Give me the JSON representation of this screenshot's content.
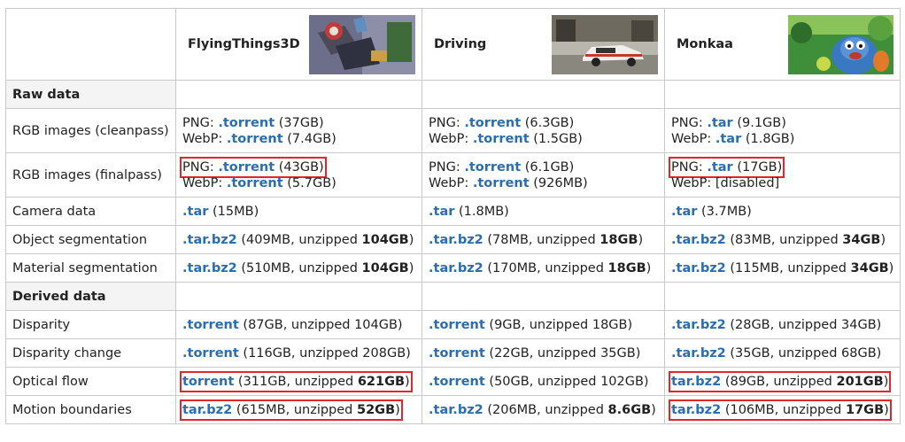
{
  "header": {
    "datasets": [
      {
        "name": "FlyingThings3D",
        "thumb_icon": "flyingthings3d-thumbnail"
      },
      {
        "name": "Driving",
        "thumb_icon": "driving-car-thumbnail"
      },
      {
        "name": "Monkaa",
        "thumb_icon": "monkaa-character-thumbnail"
      }
    ]
  },
  "sections": {
    "raw": "Raw data",
    "derived": "Derived data"
  },
  "rows": {
    "clean": {
      "label": "RGB images (cleanpass)",
      "ft": {
        "p1": "PNG: ",
        "l1": ".torrent",
        "s1": " (37GB)",
        "p2": "WebP: ",
        "l2": ".torrent",
        "s2": " (7.4GB)"
      },
      "dr": {
        "p1": "PNG: ",
        "l1": ".torrent",
        "s1": " (6.3GB)",
        "p2": "WebP: ",
        "l2": ".torrent",
        "s2": " (1.5GB)"
      },
      "mk": {
        "p1": "PNG: ",
        "l1": ".tar",
        "s1": " (9.1GB)",
        "p2": "WebP: ",
        "l2": ".tar",
        "s2": " (1.8GB)"
      }
    },
    "final": {
      "label": "RGB images (finalpass)",
      "ft": {
        "p1": "PNG: ",
        "l1": ".torrent",
        "s1": " (43GB)",
        "p2": "WebP: ",
        "l2": ".torrent",
        "s2": " (5.7GB)"
      },
      "dr": {
        "p1": "PNG: ",
        "l1": ".torrent",
        "s1": " (6.1GB)",
        "p2": "WebP: ",
        "l2": ".torrent",
        "s2": " (926MB)"
      },
      "mk": {
        "p1": "PNG: ",
        "l1": ".tar",
        "s1": " (17GB)",
        "p2": "WebP: [disabled]"
      }
    },
    "camera": {
      "label": "Camera data",
      "ft": {
        "l": ".tar",
        "s": " (15MB)"
      },
      "dr": {
        "l": ".tar",
        "s": " (1.8MB)"
      },
      "mk": {
        "l": ".tar",
        "s": " (3.7MB)"
      }
    },
    "objseg": {
      "label": "Object segmentation",
      "ft": {
        "l": ".tar.bz2",
        "s": " (409MB, unzipped ",
        "b": "104GB",
        "e": ")"
      },
      "dr": {
        "l": ".tar.bz2",
        "s": " (78MB, unzipped ",
        "b": "18GB",
        "e": ")"
      },
      "mk": {
        "l": ".tar.bz2",
        "s": " (83MB, unzipped ",
        "b": "34GB",
        "e": ")"
      }
    },
    "matseg": {
      "label": "Material segmentation",
      "ft": {
        "l": ".tar.bz2",
        "s": " (510MB, unzipped ",
        "b": "104GB",
        "e": ")"
      },
      "dr": {
        "l": ".tar.bz2",
        "s": " (170MB, unzipped ",
        "b": "18GB",
        "e": ")"
      },
      "mk": {
        "l": ".tar.bz2",
        "s": " (115MB, unzipped ",
        "b": "34GB",
        "e": ")"
      }
    },
    "disp": {
      "label": "Disparity",
      "ft": {
        "l": ".torrent",
        "s": " (87GB, unzipped 104GB)"
      },
      "dr": {
        "l": ".torrent",
        "s": " (9GB, unzipped 18GB)"
      },
      "mk": {
        "l": ".tar.bz2",
        "s": " (28GB, unzipped 34GB)"
      }
    },
    "dispch": {
      "label": "Disparity change",
      "ft": {
        "l": ".torrent",
        "s": " (116GB, unzipped 208GB)"
      },
      "dr": {
        "l": ".torrent",
        "s": " (22GB, unzipped 35GB)"
      },
      "mk": {
        "l": ".tar.bz2",
        "s": " (35GB, unzipped 68GB)"
      }
    },
    "flow": {
      "label": "Optical flow",
      "ft": {
        "l": "torrent",
        "s": " (311GB, unzipped ",
        "b": "621GB",
        "e": ")"
      },
      "dr": {
        "l": ".torrent",
        "s": " (50GB, unzipped 102GB)"
      },
      "mk": {
        "l": "tar.bz2",
        "s": " (89GB, unzipped ",
        "b": "201GB",
        "e": ")"
      }
    },
    "motion": {
      "label": "Motion boundaries",
      "ft": {
        "l": "tar.bz2",
        "s": " (615MB, unzipped ",
        "b": "52GB",
        "e": ")"
      },
      "dr": {
        "l": ".tar.bz2",
        "s": " (206MB, unzipped ",
        "b": "8.6GB",
        "e": ")"
      },
      "mk": {
        "l": "tar.bz2",
        "s": " (106MB, unzipped ",
        "b": "17GB",
        "e": ")"
      }
    }
  },
  "colors": {
    "link": "#2a6db0",
    "highlight": "#e0282b",
    "border": "#c9c9c9",
    "section_bg": "#f4f4f4"
  }
}
